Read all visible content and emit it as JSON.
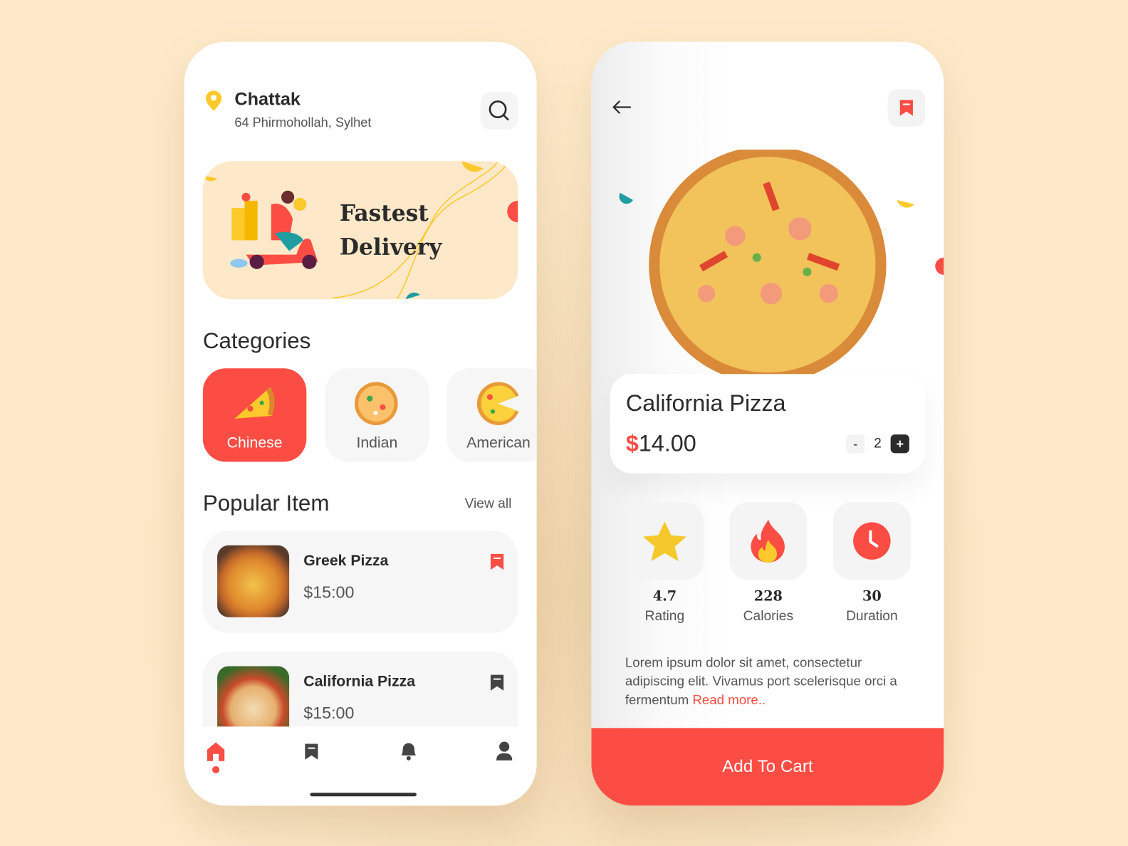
{
  "home": {
    "location_name": "Chattak",
    "address": "64 Phirmohollah, Sylhet",
    "banner": {
      "line1": "Fastest",
      "line2": "Delivery"
    },
    "categories_title": "Categories",
    "categories": [
      {
        "label": "Chinese",
        "active": true
      },
      {
        "label": "Indian",
        "active": false
      },
      {
        "label": "American",
        "active": false
      }
    ],
    "popular_title": "Popular Item",
    "view_all": "View all",
    "items": [
      {
        "name": "Greek Pizza",
        "price": "$15:00",
        "bookmarked": true
      },
      {
        "name": "California Pizza",
        "price": "$15:00",
        "bookmarked": false
      }
    ],
    "nav": [
      "home-icon",
      "bookmark-icon",
      "bell-icon",
      "user-icon"
    ]
  },
  "detail": {
    "title": "California Pizza",
    "currency": "$",
    "price": "14.00",
    "quantity": "2",
    "minus": "-",
    "plus": "+",
    "stats": [
      {
        "value": "4.7",
        "label": "Rating",
        "icon": "star-icon"
      },
      {
        "value": "228",
        "label": "Calories",
        "icon": "fire-icon"
      },
      {
        "value": "30",
        "label": "Duration",
        "icon": "clock-icon"
      }
    ],
    "description": "Lorem ipsum dolor sit amet, consectetur adipiscing elit. Vivamus port scelerisque orci a fermentum",
    "read_more": "Read more..",
    "add_to_cart": "Add To Cart"
  },
  "colors": {
    "accent": "#fb4d44",
    "yellow": "#fbc92b",
    "background": "#fde9c9",
    "teal": "#1f9da0"
  }
}
